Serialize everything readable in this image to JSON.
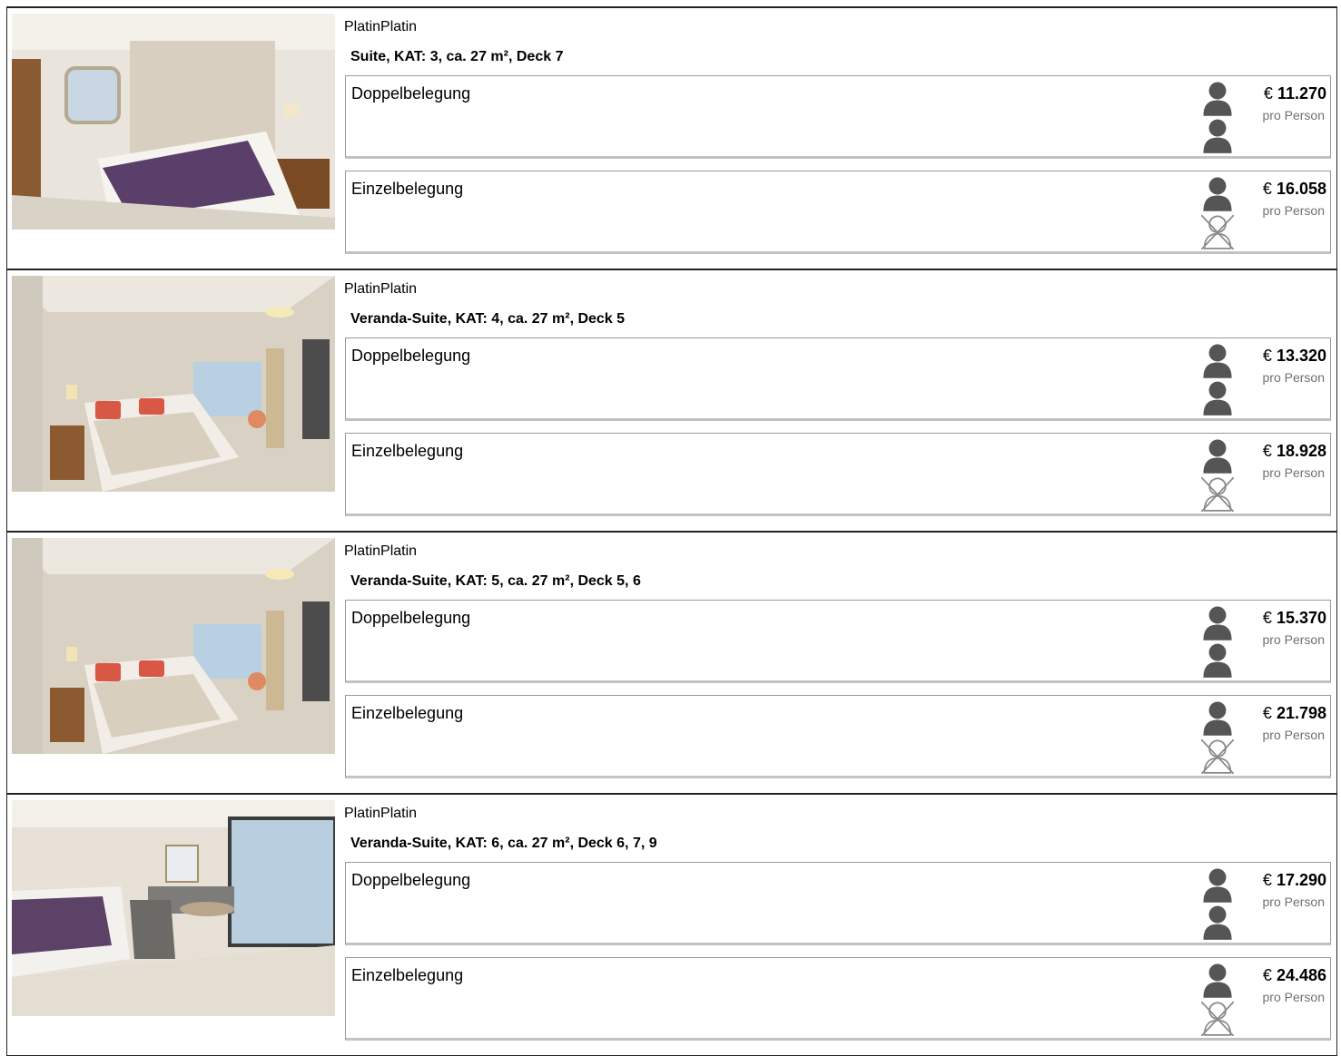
{
  "cabins": [
    {
      "photo": "cabin-photo-suite",
      "label": "PlatinPlatin",
      "title": "Suite, KAT: 3, ca. 27 m², Deck 7",
      "options": [
        {
          "label": "Doppelbelegung",
          "currency": "€",
          "price": "11.270",
          "per": "pro Person",
          "persons": 2,
          "icon": "two-person-icon"
        },
        {
          "label": "Einzelbelegung",
          "currency": "€",
          "price": "16.058",
          "per": "pro Person",
          "persons": 1,
          "icon": "single-person-icon"
        }
      ]
    },
    {
      "photo": "cabin-photo-veranda-suite",
      "label": "PlatinPlatin",
      "title": "Veranda-Suite, KAT: 4, ca. 27 m², Deck 5",
      "options": [
        {
          "label": "Doppelbelegung",
          "currency": "€",
          "price": "13.320",
          "per": "pro Person",
          "persons": 2,
          "icon": "two-person-icon"
        },
        {
          "label": "Einzelbelegung",
          "currency": "€",
          "price": "18.928",
          "per": "pro Person",
          "persons": 1,
          "icon": "single-person-icon"
        }
      ]
    },
    {
      "photo": "cabin-photo-veranda-suite",
      "label": "PlatinPlatin",
      "title": "Veranda-Suite, KAT: 5, ca. 27 m², Deck 5, 6",
      "options": [
        {
          "label": "Doppelbelegung",
          "currency": "€",
          "price": "15.370",
          "per": "pro Person",
          "persons": 2,
          "icon": "two-person-icon"
        },
        {
          "label": "Einzelbelegung",
          "currency": "€",
          "price": "21.798",
          "per": "pro Person",
          "persons": 1,
          "icon": "single-person-icon"
        }
      ]
    },
    {
      "photo": "cabin-photo-veranda-suite-balcony",
      "label": "PlatinPlatin",
      "title": "Veranda-Suite, KAT: 6, ca. 27 m², Deck 6, 7, 9",
      "options": [
        {
          "label": "Doppelbelegung",
          "currency": "€",
          "price": "17.290",
          "per": "pro Person",
          "persons": 2,
          "icon": "two-person-icon"
        },
        {
          "label": "Einzelbelegung",
          "currency": "€",
          "price": "24.486",
          "per": "pro Person",
          "persons": 1,
          "icon": "single-person-icon"
        }
      ]
    }
  ],
  "colors": {
    "person_icon": "#555555",
    "crossed_icon": "#8a8a8a",
    "sub_text": "#707070",
    "occupancy_border": "#9a9a9a"
  }
}
